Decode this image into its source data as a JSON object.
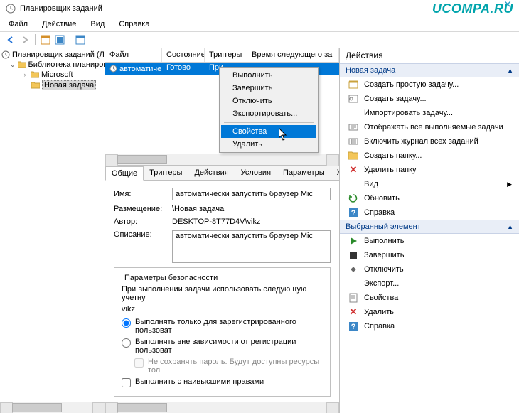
{
  "window": {
    "title": "Планировщик заданий",
    "watermark": "UCOMPA.RU"
  },
  "menubar": {
    "file": "Файл",
    "action": "Действие",
    "view": "Вид",
    "help": "Справка"
  },
  "tree": {
    "root": "Планировщик заданий (Лок",
    "library": "Библиотека планировщ",
    "microsoft": "Microsoft",
    "newtask": "Новая задача"
  },
  "tasklist": {
    "headers": {
      "file": "Файл",
      "state": "Состояние",
      "triggers": "Триггеры",
      "next": "Время следующего за"
    },
    "rows": [
      {
        "file": "автоматиче...",
        "state": "Готово",
        "triggers": "При..."
      }
    ]
  },
  "context_menu": {
    "run": "Выполнить",
    "end": "Завершить",
    "disable": "Отключить",
    "export": "Экспортировать...",
    "properties": "Свойства",
    "delete": "Удалить"
  },
  "tabs": {
    "general": "Общие",
    "triggers": "Триггеры",
    "actions": "Действия",
    "conditions": "Условия",
    "settings": "Параметры",
    "x": "Х"
  },
  "form": {
    "name_label": "Имя:",
    "name_value": "автоматически запустить браузер Mic",
    "location_label": "Размещение:",
    "location_value": "\\Новая задача",
    "author_label": "Автор:",
    "author_value": "DESKTOP-8T77D4V\\vikz",
    "desc_label": "Описание:",
    "desc_value": "автоматически запустить браузер Mic"
  },
  "security": {
    "legend": "Параметры безопасности",
    "line1": "При выполнении задачи использовать следующую учетну",
    "user": "vikz",
    "radio1": "Выполнять только для зарегистрированного пользоват",
    "radio2": "Выполнять вне зависимости от регистрации пользоват",
    "check1": "Не сохранять пароль. Будут доступны ресурсы тол",
    "check2": "Выполнить с наивысшими правами"
  },
  "actions_panel": {
    "title": "Действия",
    "group1": "Новая задача",
    "create_basic": "Создать простую задачу...",
    "create": "Создать задачу...",
    "import": "Импортировать задачу...",
    "show_running": "Отображать все выполняемые задачи",
    "enable_history": "Включить журнал всех заданий",
    "new_folder": "Создать папку...",
    "delete_folder": "Удалить папку",
    "view": "Вид",
    "refresh": "Обновить",
    "help": "Справка",
    "group2": "Выбранный элемент",
    "run": "Выполнить",
    "end": "Завершить",
    "disable": "Отключить",
    "export": "Экспорт...",
    "properties": "Свойства",
    "delete": "Удалить",
    "help2": "Справка"
  }
}
